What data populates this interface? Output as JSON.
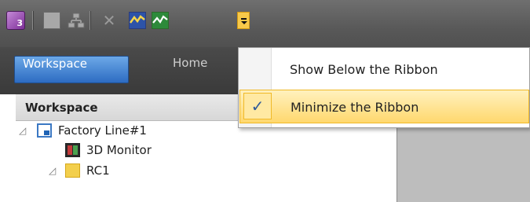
{
  "toolbar": {
    "app_icon_label": "3",
    "icons": [
      "app-icon",
      "save-icon",
      "network-icon",
      "cross-icon",
      "chart-icon",
      "chart2-icon",
      "dropdown-icon"
    ]
  },
  "tabs": [
    {
      "label": "Workspace",
      "active": true
    },
    {
      "label": "Home",
      "active": false
    }
  ],
  "workspace": {
    "header": "Workspace",
    "tree": [
      {
        "label": "Factory Line#1",
        "level": 0,
        "expanded": true,
        "icon": "factory-icon"
      },
      {
        "label": "3D Monitor",
        "level": 1,
        "icon": "monitor-icon"
      },
      {
        "label": "RC1",
        "level": 1,
        "expanded": true,
        "icon": "rc-icon"
      }
    ]
  },
  "menu": {
    "items": [
      {
        "label": "Show Below the Ribbon",
        "checked": false
      },
      {
        "label": "Minimize the Ribbon",
        "checked": true
      }
    ],
    "check_mark": "✓"
  }
}
